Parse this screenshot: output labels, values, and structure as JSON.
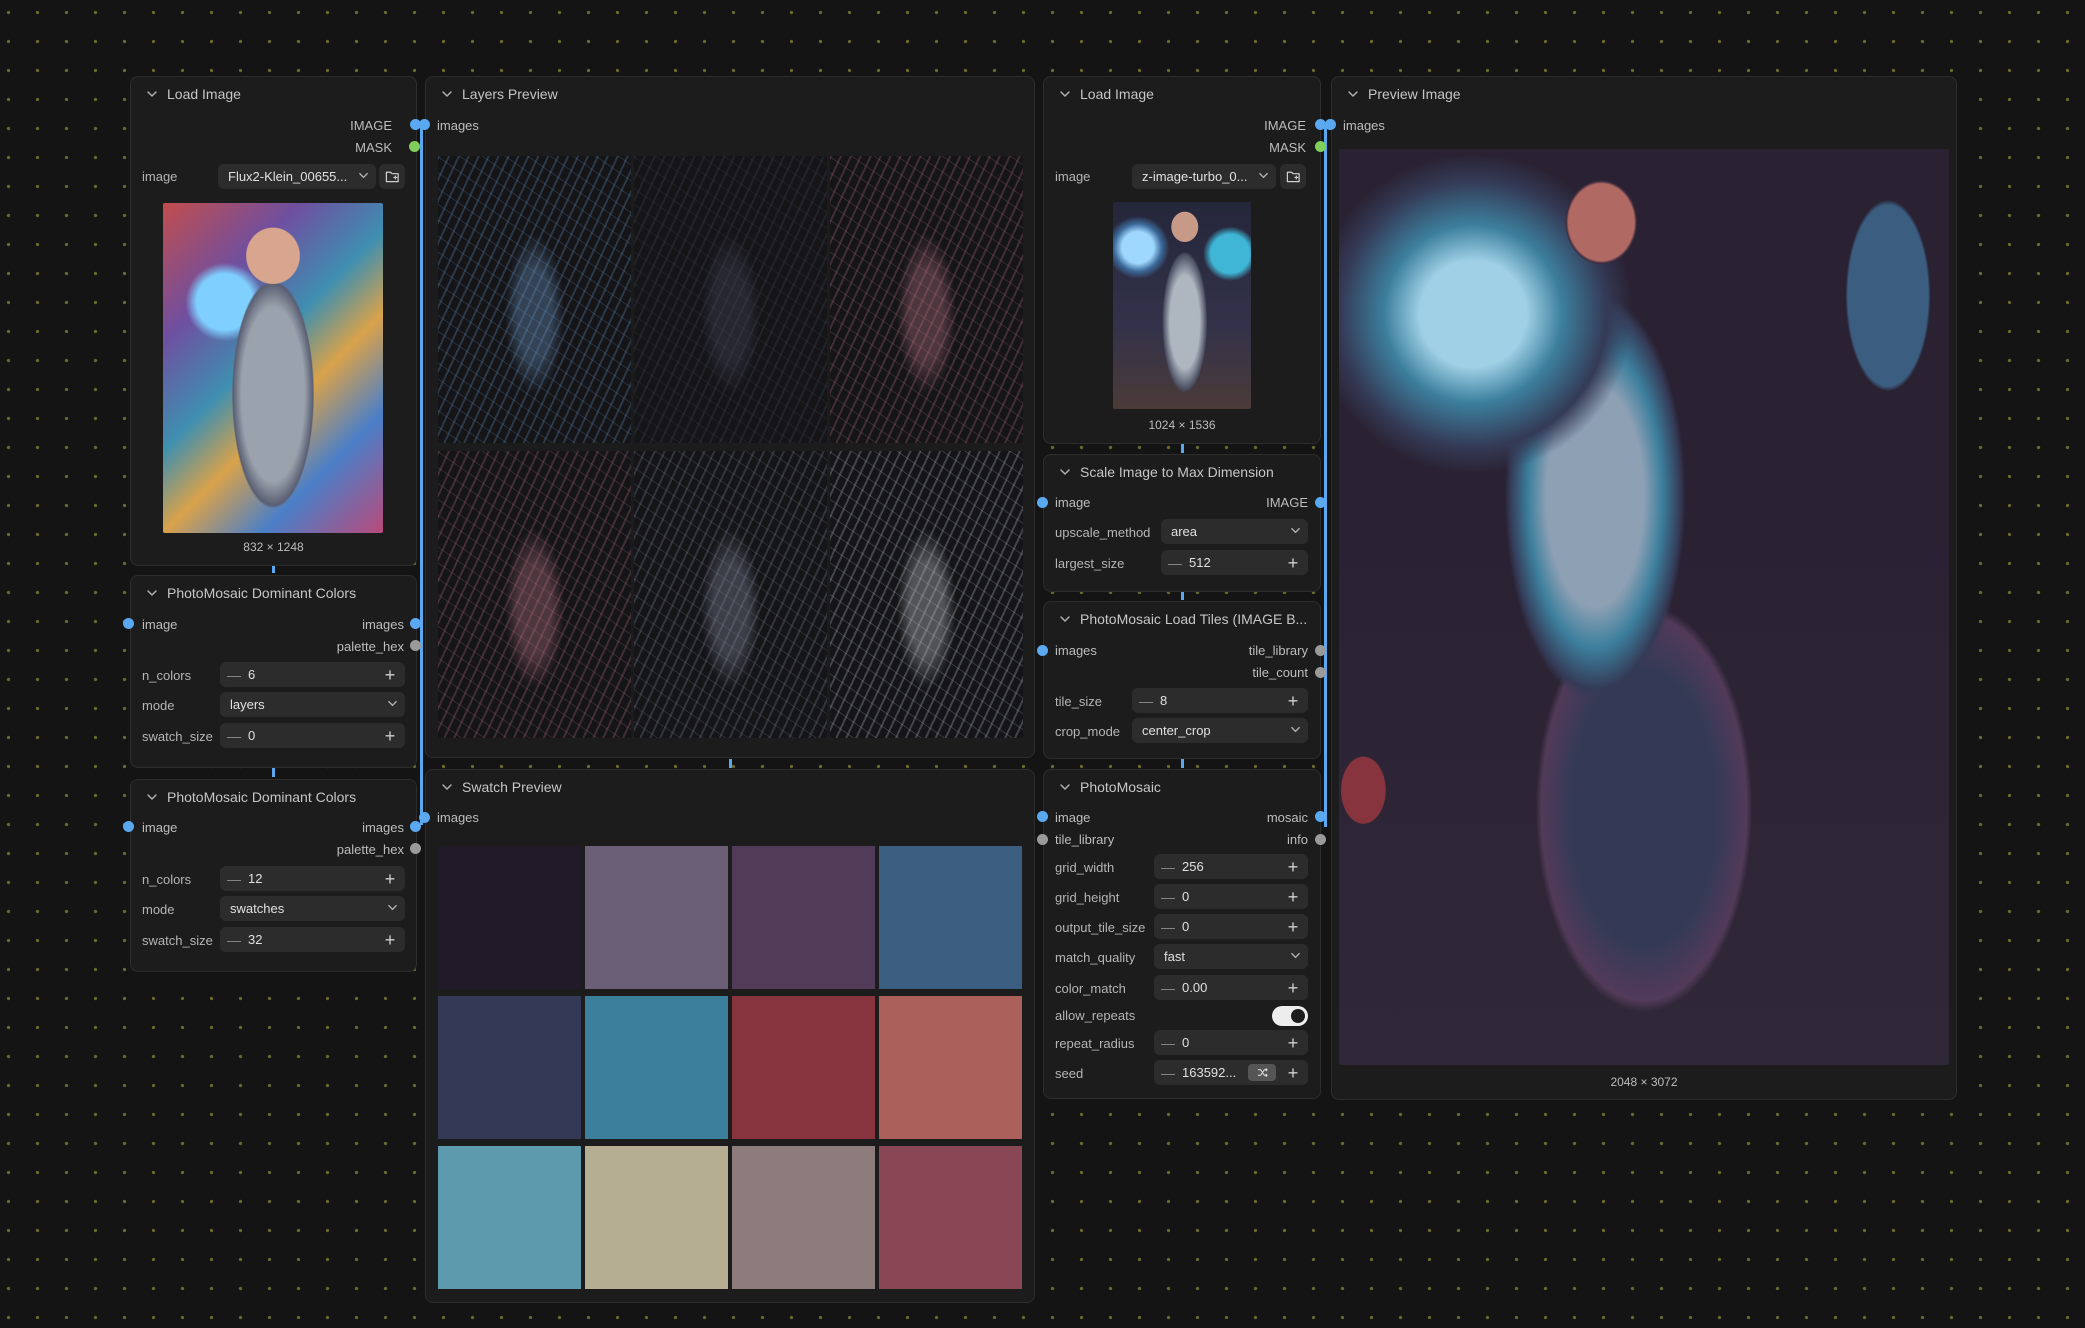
{
  "nodes": {
    "load_image_1": {
      "title": "Load Image",
      "out_image": "IMAGE",
      "out_mask": "MASK",
      "image_label": "image",
      "image_value": "Flux2-Klein_00655...",
      "dims": "832 × 1248"
    },
    "dominant_1": {
      "title": "PhotoMosaic Dominant Colors",
      "in_image": "image",
      "out_images": "images",
      "out_palette": "palette_hex",
      "n_colors_label": "n_colors",
      "n_colors": "6",
      "mode_label": "mode",
      "mode": "layers",
      "swatch_size_label": "swatch_size",
      "swatch_size": "0"
    },
    "dominant_2": {
      "title": "PhotoMosaic Dominant Colors",
      "in_image": "image",
      "out_images": "images",
      "out_palette": "palette_hex",
      "n_colors_label": "n_colors",
      "n_colors": "12",
      "mode_label": "mode",
      "mode": "swatches",
      "swatch_size_label": "swatch_size",
      "swatch_size": "32"
    },
    "layers_preview": {
      "title": "Layers Preview",
      "in_images": "images"
    },
    "swatch_preview": {
      "title": "Swatch Preview",
      "in_images": "images"
    },
    "load_image_2": {
      "title": "Load Image",
      "out_image": "IMAGE",
      "out_mask": "MASK",
      "image_label": "image",
      "image_value": "z-image-turbo_0...",
      "dims": "1024 × 1536"
    },
    "scale_image": {
      "title": "Scale Image to Max Dimension",
      "in_image": "image",
      "out_image": "IMAGE",
      "upscale_method_label": "upscale_method",
      "upscale_method": "area",
      "largest_size_label": "largest_size",
      "largest_size": "512"
    },
    "load_tiles": {
      "title": "PhotoMosaic Load Tiles (IMAGE B...",
      "in_images": "images",
      "out_tile_library": "tile_library",
      "out_tile_count": "tile_count",
      "tile_size_label": "tile_size",
      "tile_size": "8",
      "crop_mode_label": "crop_mode",
      "crop_mode": "center_crop"
    },
    "photomosaic": {
      "title": "PhotoMosaic",
      "in_image": "image",
      "in_tile_library": "tile_library",
      "out_mosaic": "mosaic",
      "out_info": "info",
      "grid_width_label": "grid_width",
      "grid_width": "256",
      "grid_height_label": "grid_height",
      "grid_height": "0",
      "output_tile_size_label": "output_tile_size",
      "output_tile_size": "0",
      "match_quality_label": "match_quality",
      "match_quality": "fast",
      "color_match_label": "color_match",
      "color_match": "0.00",
      "allow_repeats_label": "allow_repeats",
      "allow_repeats": true,
      "repeat_radius_label": "repeat_radius",
      "repeat_radius": "0",
      "seed_label": "seed",
      "seed": "163592..."
    },
    "preview_image": {
      "title": "Preview Image",
      "in_images": "images",
      "dims": "2048 × 3072"
    }
  },
  "swatch_colors": [
    "#211a28",
    "#6b5e77",
    "#523a59",
    "#3a5d80",
    "#343a56",
    "#3c7f9d",
    "#88343e",
    "#ac605c",
    "#5e9aad",
    "#b6ae92",
    "#8d7c7b",
    "#894654"
  ],
  "layer_tints": [
    "#6f9ecf",
    "#4a4a60",
    "#c07789",
    "#c07789",
    "#8a92a8",
    "#c9d0d8"
  ],
  "colors": {
    "link": "#5aa9f0",
    "node_bg": "#1c1c1c",
    "canvas_bg": "#141414",
    "grid_dot": "#6b6a2e"
  }
}
